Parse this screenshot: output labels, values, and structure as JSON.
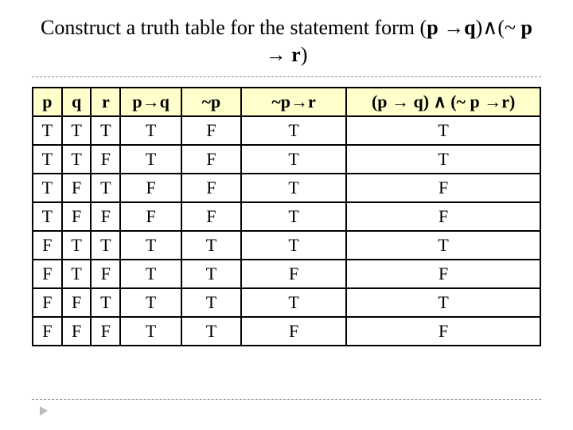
{
  "title": {
    "prefix": "Construct a truth table for the statement form (",
    "bold1": "p",
    "mid1": " →",
    "bold2": "q",
    "mid2": ")∧(~ ",
    "bold3": "p",
    "mid3": " → ",
    "bold4": "r",
    "suffix": ")"
  },
  "table": {
    "headers": {
      "p": "p",
      "q": "q",
      "r": "r",
      "p_imp_q": "p→q",
      "not_p": "~p",
      "notp_imp_r": "~p→r",
      "conj": "(p → q) ∧ (~ p →r)"
    },
    "rows": [
      {
        "p": "T",
        "q": "T",
        "r": "T",
        "p_imp_q": "T",
        "not_p": "F",
        "notp_imp_r": "T",
        "conj": "T"
      },
      {
        "p": "T",
        "q": "T",
        "r": "F",
        "p_imp_q": "T",
        "not_p": "F",
        "notp_imp_r": "T",
        "conj": "T"
      },
      {
        "p": "T",
        "q": "F",
        "r": "T",
        "p_imp_q": "F",
        "not_p": "F",
        "notp_imp_r": "T",
        "conj": "F"
      },
      {
        "p": "T",
        "q": "F",
        "r": "F",
        "p_imp_q": "F",
        "not_p": "F",
        "notp_imp_r": "T",
        "conj": "F"
      },
      {
        "p": "F",
        "q": "T",
        "r": "T",
        "p_imp_q": "T",
        "not_p": "T",
        "notp_imp_r": "T",
        "conj": "T"
      },
      {
        "p": "F",
        "q": "T",
        "r": "F",
        "p_imp_q": "T",
        "not_p": "T",
        "notp_imp_r": "F",
        "conj": "F"
      },
      {
        "p": "F",
        "q": "F",
        "r": "T",
        "p_imp_q": "T",
        "not_p": "T",
        "notp_imp_r": "T",
        "conj": "T"
      },
      {
        "p": "F",
        "q": "F",
        "r": "F",
        "p_imp_q": "T",
        "not_p": "T",
        "notp_imp_r": "F",
        "conj": "F"
      }
    ]
  },
  "chart_data": {
    "type": "table",
    "title": "Truth table for (p → q) ∧ (~p → r)",
    "columns": [
      "p",
      "q",
      "r",
      "p→q",
      "~p",
      "~p→r",
      "(p→q)∧(~p→r)"
    ],
    "rows": [
      [
        "T",
        "T",
        "T",
        "T",
        "F",
        "T",
        "T"
      ],
      [
        "T",
        "T",
        "F",
        "T",
        "F",
        "T",
        "T"
      ],
      [
        "T",
        "F",
        "T",
        "F",
        "F",
        "T",
        "F"
      ],
      [
        "T",
        "F",
        "F",
        "F",
        "F",
        "T",
        "F"
      ],
      [
        "F",
        "T",
        "T",
        "T",
        "T",
        "T",
        "T"
      ],
      [
        "F",
        "T",
        "F",
        "T",
        "T",
        "F",
        "F"
      ],
      [
        "F",
        "F",
        "T",
        "T",
        "T",
        "T",
        "T"
      ],
      [
        "F",
        "F",
        "F",
        "T",
        "T",
        "F",
        "F"
      ]
    ]
  }
}
